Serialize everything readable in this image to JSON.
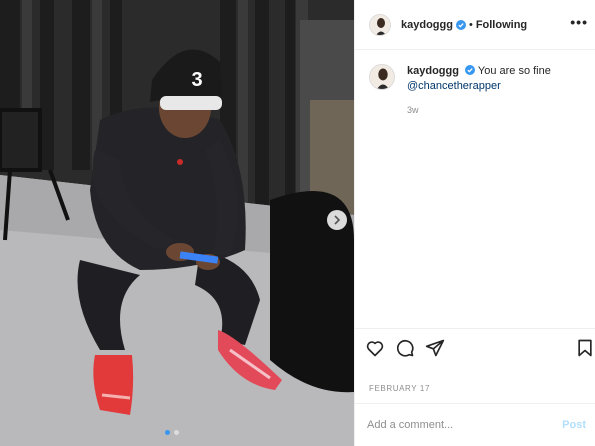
{
  "post": {
    "username": "kaydoggg",
    "separator": "•",
    "follow_status": "Following",
    "more_label": "•••",
    "caption_username": "kaydoggg",
    "caption_text": "You are so fine",
    "caption_mention": "@chancetherapper",
    "time_ago": "3w",
    "date": "FEBRUARY 17",
    "comment_placeholder": "Add a comment...",
    "post_label": "Post",
    "cap_number": "3"
  },
  "icons": {
    "verified": "verified-badge-icon",
    "like": "heart-icon",
    "comment": "comment-bubble-icon",
    "share": "paper-plane-icon",
    "save": "bookmark-icon",
    "next": "chevron-right-icon"
  },
  "carousel": {
    "count": 2,
    "active_index": 0
  },
  "colors": {
    "accent": "#3897f0",
    "link": "#00376b",
    "muted": "#8e8e8e",
    "post_disabled": "#b2dffc"
  }
}
